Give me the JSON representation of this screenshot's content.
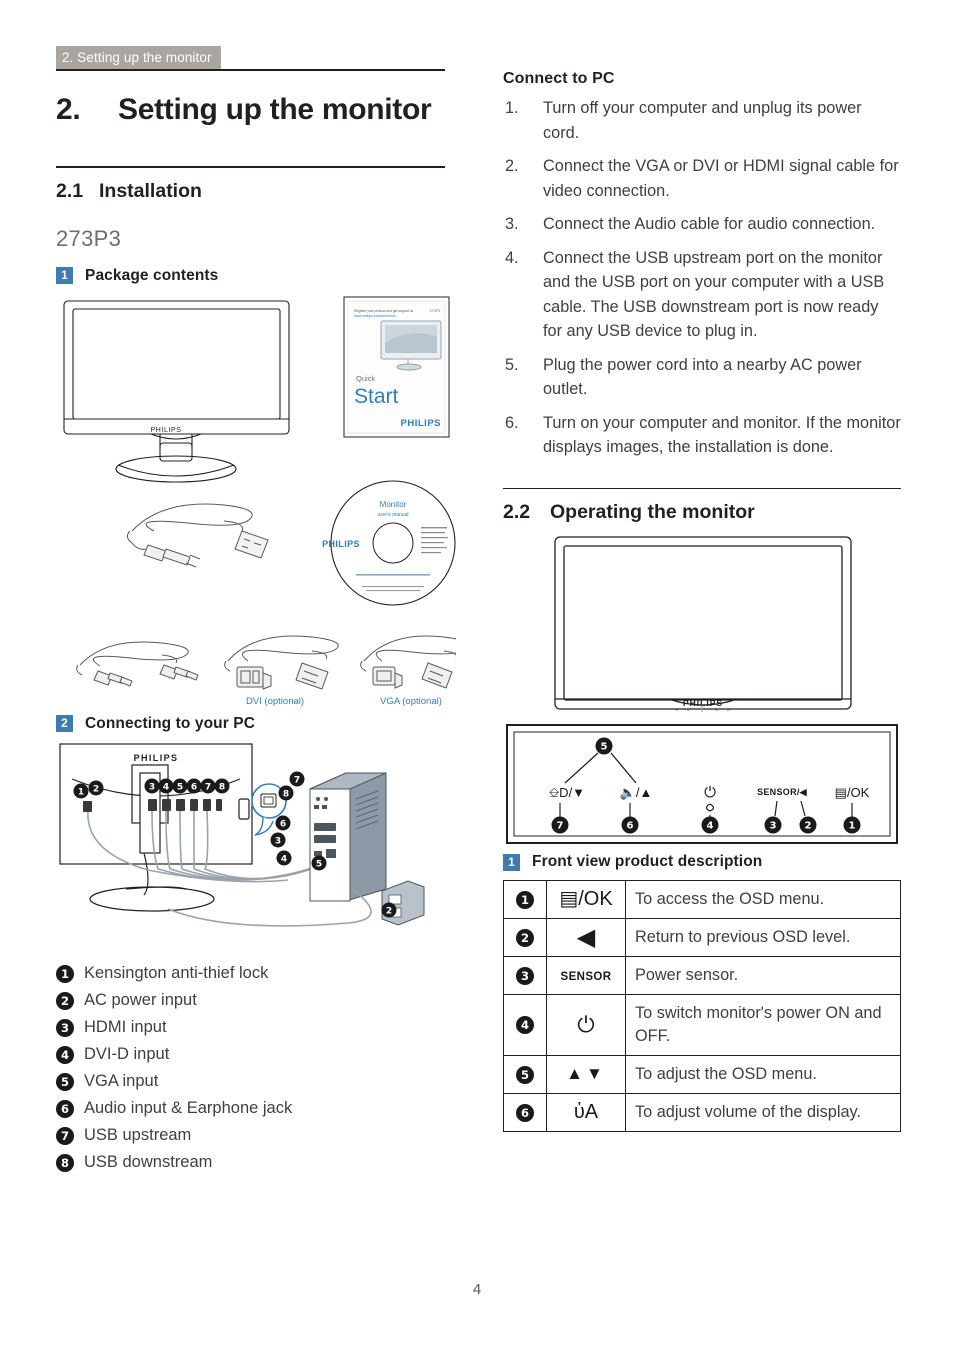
{
  "running_header": "2. Setting up the monitor",
  "page_number": "4",
  "colors": {
    "header_bar": "#aba5a0",
    "badge_blue": "#3d7cb0",
    "label_blue": "#2e7fc1",
    "text": "#231f20"
  },
  "chapter": {
    "number": "2.",
    "title": "Setting up the monitor"
  },
  "section_installation": {
    "number": "2.1",
    "title": "Installation",
    "model": "273P3",
    "package_contents": {
      "badge": "1",
      "title": "Package contents"
    },
    "connecting": {
      "badge": "2",
      "title": "Connecting to your PC"
    },
    "art_labels": {
      "quick_start_small": "Register your product and get support at",
      "quick_start_url": "www.philips.com/welcome",
      "quick_start_word1": "Quick",
      "quick_start_word2": "Start",
      "brand": "PHILIPS",
      "cd_line1": "Monitor",
      "cd_line2": "user's manual",
      "cd_brand": "PHILIPS",
      "cable_dvi": "DVI (optional)",
      "cable_vga": "VGA (optional)",
      "monitor_brand": "PHILIPS"
    },
    "legend": [
      {
        "n": "1",
        "label": "Kensington anti-thief lock"
      },
      {
        "n": "2",
        "label": "AC power input"
      },
      {
        "n": "3",
        "label": "HDMI input"
      },
      {
        "n": "4",
        "label": "DVI-D input"
      },
      {
        "n": "5",
        "label": "VGA input"
      },
      {
        "n": "6",
        "label": "Audio input & Earphone jack"
      },
      {
        "n": "7",
        "label": "USB upstream"
      },
      {
        "n": "8",
        "label": "USB downstream"
      }
    ]
  },
  "connect_to_pc": {
    "title": "Connect to PC",
    "steps": [
      {
        "n": "1.",
        "text": "Turn off your computer and unplug its power cord."
      },
      {
        "n": "2.",
        "text": "Connect the VGA or DVI or HDMI signal cable for video connection."
      },
      {
        "n": "3.",
        "text": "Connect the Audio cable for audio connection."
      },
      {
        "n": "4.",
        "text": "Connect the USB upstream port on the monitor and the USB port on your computer with a USB cable. The USB downstream port is now ready for any USB device to plug in."
      },
      {
        "n": "5.",
        "text": "Plug the power cord into a nearby AC power outlet."
      },
      {
        "n": "6.",
        "text": "Turn on your computer and monitor. If the monitor displays images, the installation is done."
      }
    ]
  },
  "section_operating": {
    "number": "2.2",
    "title": "Operating the monitor",
    "front_view": {
      "badge": "1",
      "title": "Front view product description"
    },
    "front_panel_labels": {
      "top_callout": "5",
      "b7_icon": "ᴇĐ/▼",
      "b7_num": "7",
      "b6_icon": "◂)/▲",
      "b6_num": "6",
      "b4_num": "4",
      "b3_icon": "SENSOR/◀",
      "b3_num": "3",
      "b2_num": "2",
      "b1_icon": "▤/OK",
      "b1_num": "1",
      "brand": "PHILIPS"
    },
    "table": [
      {
        "n": "1",
        "icon": "▤/OK",
        "icon_kind": "ok",
        "desc": "To access the OSD menu."
      },
      {
        "n": "2",
        "icon": "◀",
        "icon_kind": "left",
        "desc": "Return to previous OSD level."
      },
      {
        "n": "3",
        "icon": "SENSOR",
        "icon_kind": "sensor",
        "desc": "Power sensor."
      },
      {
        "n": "4",
        "icon": "⏻",
        "icon_kind": "power",
        "desc": "To switch monitor's power ON and OFF."
      },
      {
        "n": "5",
        "icon": "▲▼",
        "icon_kind": "updown",
        "desc": "To adjust the OSD menu."
      },
      {
        "n": "6",
        "icon": "ὐA",
        "icon_kind": "volume",
        "desc": "To adjust volume of the display."
      }
    ]
  }
}
